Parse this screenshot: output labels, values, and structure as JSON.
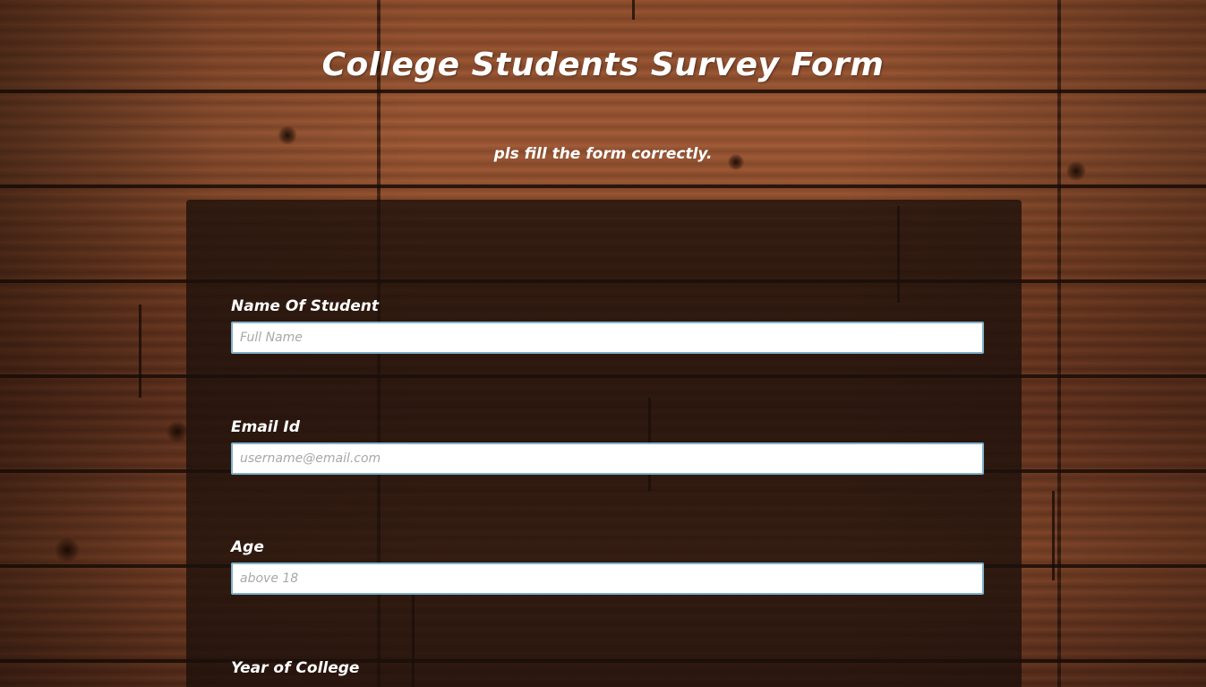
{
  "page": {
    "title": "College Students Survey Form",
    "description": "pls fill the form correctly."
  },
  "form": {
    "fields": [
      {
        "label": "Name Of Student",
        "placeholder": "Full Name",
        "value": ""
      },
      {
        "label": "Email Id",
        "placeholder": "username@email.com",
        "value": ""
      },
      {
        "label": "Age",
        "placeholder": "above 18",
        "value": ""
      }
    ],
    "year_of_college": {
      "label": "Year of College"
    }
  },
  "colors": {
    "text": "#ffffff",
    "form_background": "#1b0f0a",
    "input_border": "#7fb0c9",
    "wood": "#8a4a2a"
  }
}
